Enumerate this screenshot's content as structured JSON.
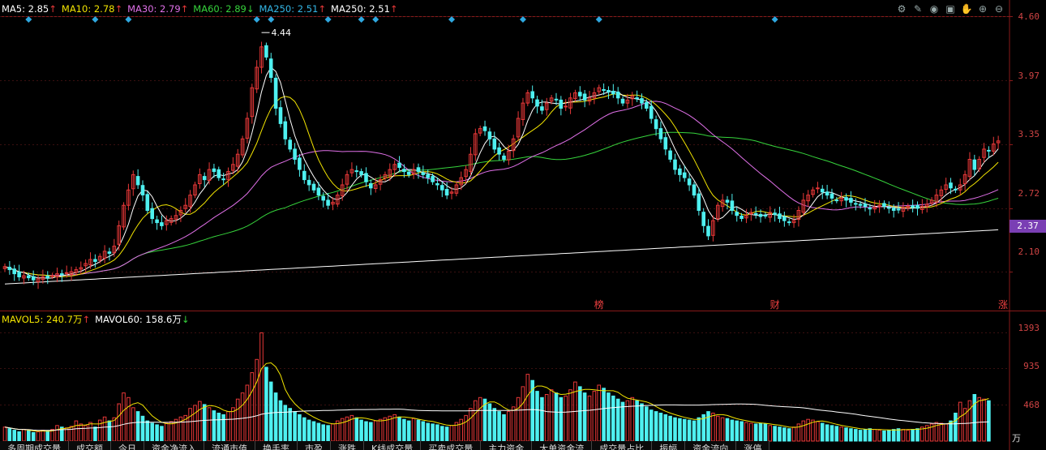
{
  "legend_top": [
    {
      "label": "MA5: 2.85",
      "arrow": "↑",
      "color": "#ffffff"
    },
    {
      "label": "MA10: 2.78",
      "arrow": "↑",
      "color": "#f2e400"
    },
    {
      "label": "MA30: 2.79",
      "arrow": "↑",
      "color": "#e070e8"
    },
    {
      "label": "MA60: 2.89",
      "arrow": "↓",
      "color": "#36d43c"
    },
    {
      "label": "MA250: 2.51",
      "arrow": "↑",
      "color": "#34b8e8"
    },
    {
      "label": "MA250: 2.51",
      "arrow": "↑",
      "color": "#ffffff"
    }
  ],
  "legend_bottom": [
    {
      "label": "MAVOL5: 240.7万",
      "arrow": "↑",
      "color": "#f2e400"
    },
    {
      "label": "MAVOL60: 158.6万",
      "arrow": "↓",
      "color": "#ffffff"
    }
  ],
  "price_axis": [
    "4.60",
    "3.97",
    "3.35",
    "2.72",
    "2.10"
  ],
  "current_price": "2.37",
  "volume_axis": [
    "1393",
    "935",
    "468"
  ],
  "volume_unit": "万",
  "high_label": "4.44",
  "event_markers": [
    {
      "label": "榜",
      "day": 125
    },
    {
      "label": "财",
      "day": 162
    },
    {
      "label": "涨",
      "day": 210
    }
  ],
  "toolbar_icons": [
    "gear-icon",
    "pen-icon",
    "eye-icon",
    "briefcase-icon",
    "hand-icon",
    "plus-icon",
    "minus-icon"
  ],
  "tabs": [
    "多周期成交量",
    "成交额",
    "今日",
    "资金净流入",
    "流通市值",
    "换手率",
    "市盈",
    "涨跌",
    "K线成交量",
    "买卖成交量",
    "主力资金",
    "大单资金流",
    "成交量占比",
    "振幅",
    "资金流向",
    "涨停"
  ],
  "colors": {
    "up": "#e83838",
    "down": "#4ef0f0",
    "grid": "#3a1010",
    "axis": "#8a1a1a"
  },
  "chart_data": [
    {
      "type": "candlestick",
      "title": "",
      "ylim": [
        1.72,
        4.6
      ],
      "y_ticks": [
        4.6,
        3.97,
        3.35,
        2.72,
        2.1
      ],
      "max_price": 4.44,
      "ma_lines": {
        "MA5": {
          "color": "#ffffff",
          "last": 2.85
        },
        "MA10": {
          "color": "#f2e400",
          "last": 2.78
        },
        "MA30": {
          "color": "#e070e8",
          "last": 2.79
        },
        "MA60": {
          "color": "#36d43c",
          "last": 2.89
        },
        "MA250": {
          "color": "#ffffff",
          "last": 2.51
        }
      },
      "diamond_days": [
        5,
        19,
        26,
        53,
        56,
        68,
        75,
        78,
        94,
        109,
        125,
        162
      ],
      "closes": [
        2.15,
        2.12,
        2.08,
        2.05,
        2.06,
        2.04,
        2.02,
        2.03,
        2.05,
        2.04,
        2.06,
        2.08,
        2.07,
        2.09,
        2.1,
        2.12,
        2.14,
        2.18,
        2.22,
        2.2,
        2.25,
        2.3,
        2.28,
        2.35,
        2.55,
        2.75,
        2.9,
        3.05,
        2.95,
        2.85,
        2.7,
        2.62,
        2.58,
        2.55,
        2.6,
        2.62,
        2.65,
        2.7,
        2.75,
        2.85,
        2.95,
        3.05,
        3.0,
        3.1,
        3.08,
        3.02,
        3.0,
        3.08,
        3.15,
        3.25,
        3.4,
        3.6,
        3.9,
        4.1,
        4.3,
        4.2,
        4.0,
        3.7,
        3.55,
        3.4,
        3.3,
        3.2,
        3.1,
        3.0,
        2.95,
        2.9,
        2.85,
        2.8,
        2.75,
        2.78,
        2.85,
        2.95,
        3.05,
        3.1,
        3.08,
        3.05,
        2.98,
        2.92,
        2.95,
        3.0,
        3.05,
        3.1,
        3.15,
        3.12,
        3.08,
        3.05,
        3.1,
        3.08,
        3.05,
        3.02,
        2.98,
        2.95,
        2.9,
        2.85,
        2.88,
        2.95,
        3.02,
        3.1,
        3.25,
        3.45,
        3.5,
        3.48,
        3.4,
        3.3,
        3.25,
        3.2,
        3.28,
        3.4,
        3.6,
        3.75,
        3.85,
        3.8,
        3.72,
        3.68,
        3.75,
        3.8,
        3.78,
        3.7,
        3.72,
        3.8,
        3.85,
        3.82,
        3.78,
        3.8,
        3.85,
        3.9,
        3.88,
        3.86,
        3.84,
        3.8,
        3.75,
        3.78,
        3.82,
        3.8,
        3.75,
        3.7,
        3.6,
        3.5,
        3.4,
        3.3,
        3.2,
        3.1,
        3.05,
        3.02,
        2.95,
        2.85,
        2.7,
        2.55,
        2.45,
        2.6,
        2.75,
        2.8,
        2.78,
        2.7,
        2.65,
        2.62,
        2.65,
        2.68,
        2.66,
        2.64,
        2.65,
        2.68,
        2.66,
        2.62,
        2.6,
        2.58,
        2.6,
        2.7,
        2.8,
        2.85,
        2.9,
        2.92,
        2.88,
        2.85,
        2.82,
        2.8,
        2.82,
        2.8,
        2.78,
        2.76,
        2.75,
        2.74,
        2.72,
        2.73,
        2.75,
        2.74,
        2.72,
        2.7,
        2.71,
        2.73,
        2.74,
        2.73,
        2.72,
        2.74,
        2.76,
        2.8,
        2.85,
        2.9,
        2.95,
        2.92,
        2.9,
        2.95,
        3.05,
        3.2,
        3.1,
        3.2,
        3.3,
        3.28,
        3.35,
        3.38
      ]
    },
    {
      "type": "bar",
      "title": "",
      "ylim": [
        0,
        1450
      ],
      "y_ticks": [
        1393,
        935,
        468
      ],
      "series": [
        {
          "name": "MAVOL5",
          "color": "#f2e400",
          "last": 240.7
        },
        {
          "name": "MAVOL60",
          "color": "#ffffff",
          "last": 158.6
        }
      ],
      "volumes": [
        180,
        160,
        140,
        120,
        150,
        130,
        110,
        120,
        140,
        130,
        150,
        200,
        180,
        170,
        190,
        260,
        220,
        200,
        240,
        180,
        270,
        310,
        260,
        300,
        480,
        620,
        560,
        430,
        380,
        320,
        260,
        230,
        210,
        190,
        230,
        250,
        280,
        310,
        330,
        420,
        460,
        510,
        470,
        430,
        390,
        360,
        340,
        380,
        430,
        540,
        620,
        720,
        880,
        1050,
        1393,
        950,
        760,
        620,
        520,
        460,
        420,
        380,
        340,
        300,
        270,
        250,
        230,
        210,
        200,
        220,
        260,
        290,
        310,
        330,
        300,
        270,
        250,
        240,
        260,
        280,
        300,
        320,
        340,
        310,
        280,
        260,
        290,
        270,
        250,
        230,
        220,
        210,
        190,
        180,
        200,
        240,
        280,
        330,
        420,
        520,
        560,
        540,
        480,
        420,
        380,
        340,
        380,
        440,
        560,
        700,
        860,
        780,
        640,
        560,
        600,
        660,
        620,
        560,
        580,
        660,
        760,
        700,
        620,
        580,
        640,
        720,
        680,
        620,
        580,
        540,
        500,
        520,
        560,
        520,
        480,
        440,
        400,
        380,
        360,
        340,
        320,
        300,
        290,
        280,
        270,
        260,
        300,
        340,
        380,
        360,
        320,
        300,
        290,
        270,
        260,
        250,
        240,
        230,
        220,
        230,
        220,
        200,
        190,
        180,
        170,
        160,
        180,
        220,
        260,
        280,
        270,
        250,
        230,
        210,
        200,
        190,
        180,
        170,
        160,
        150,
        140,
        150,
        160,
        150,
        140,
        130,
        140,
        150,
        160,
        150,
        140,
        150,
        160,
        180,
        200,
        220,
        240,
        230,
        220,
        260,
        360,
        500,
        420,
        520,
        600,
        560,
        540,
        520
      ]
    }
  ]
}
